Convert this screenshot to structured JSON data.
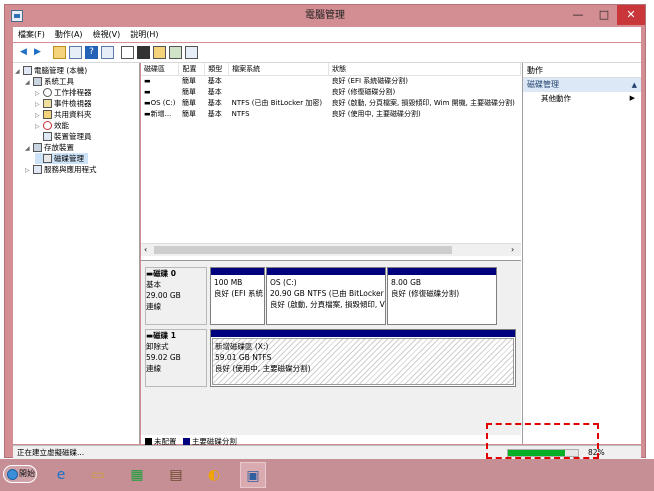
{
  "window": {
    "title": "電腦管理",
    "min": "—",
    "max": "□",
    "close": "✕"
  },
  "menu": [
    "檔案(F)",
    "動作(A)",
    "檢視(V)",
    "說明(H)"
  ],
  "toolbar_icons": [
    "back-icon",
    "forward-icon",
    "up-folder-icon",
    "show-tree-icon",
    "help-icon",
    "details-icon",
    "new-icon",
    "connect-icon",
    "search-icon",
    "properties-icon",
    "settings-icon"
  ],
  "tree": [
    {
      "label": "電腦管理 (本機)",
      "icon": "computer-icon"
    },
    {
      "label": "系統工具",
      "icon": "tools-icon"
    },
    {
      "label": "工作排程器",
      "icon": "clock-icon"
    },
    {
      "label": "事件檢視器",
      "icon": "event-icon"
    },
    {
      "label": "共用資料夾",
      "icon": "folder-icon"
    },
    {
      "label": "效能",
      "icon": "performance-icon"
    },
    {
      "label": "裝置管理員",
      "icon": "device-icon"
    },
    {
      "label": "存放裝置",
      "icon": "storage-icon"
    },
    {
      "label": "磁碟管理",
      "icon": "disk-icon"
    },
    {
      "label": "服務與應用程式",
      "icon": "services-icon"
    }
  ],
  "volume_table": {
    "headers": [
      "磁碟區",
      "配置",
      "類型",
      "檔案系統",
      "狀態"
    ],
    "rows": [
      [
        "",
        "簡單",
        "基本",
        "",
        "良好 (EFI 系統磁碟分割)"
      ],
      [
        "",
        "簡單",
        "基本",
        "",
        "良好 (修復磁碟分割)"
      ],
      [
        "OS (C:)",
        "簡單",
        "基本",
        "NTFS (已由 BitLocker 加密)",
        "良好 (啟動, 分頁檔案, 損毀傾印, Wim 開機, 主要磁碟分割)"
      ],
      [
        "新增...",
        "簡單",
        "基本",
        "NTFS",
        "良好 (使用中, 主要磁碟分割)"
      ]
    ]
  },
  "disks": [
    {
      "name": "磁碟 0",
      "type": "基本",
      "size": "29.00 GB",
      "status": "連線",
      "partitions": [
        {
          "title": "",
          "size": "100 MB",
          "status": "良好 (EFI 系統"
        },
        {
          "title": "OS (C:)",
          "size": "20.90 GB NTFS (已由 BitLocker 加",
          "status": "良好 (啟動, 分頁檔案, 損毀傾印, V"
        },
        {
          "title": "",
          "size": "8.00 GB",
          "status": "良好 (修復磁碟分割)"
        }
      ]
    },
    {
      "name": "磁碟 1",
      "type": "卸除式",
      "size": "59.02 GB",
      "status": "連線",
      "partitions": [
        {
          "title": "新增磁碟區 (X:)",
          "size": "59.01 GB NTFS",
          "status": "良好 (使用中, 主要磁碟分割)"
        }
      ]
    }
  ],
  "legend": [
    {
      "label": "未配置",
      "color": "#000000"
    },
    {
      "label": "主要磁碟分割",
      "color": "#00007f"
    }
  ],
  "actions": {
    "header": "動作",
    "section": "磁碟管理",
    "item": "其他動作"
  },
  "status": {
    "text": "正在建立虛擬磁碟...",
    "progress_fraction": 0.82,
    "percent_text": "82%"
  },
  "taskbar": {
    "start": "開始",
    "icons": [
      "ie-icon",
      "explorer-icon",
      "store-icon",
      "computer-management-icon",
      "pacman-icon",
      "disk-management-icon"
    ]
  },
  "colors": {
    "titlebar": "#d28e93",
    "disk_bar": "#00007f",
    "progress": "#06b025",
    "highlight": "#e00000"
  }
}
